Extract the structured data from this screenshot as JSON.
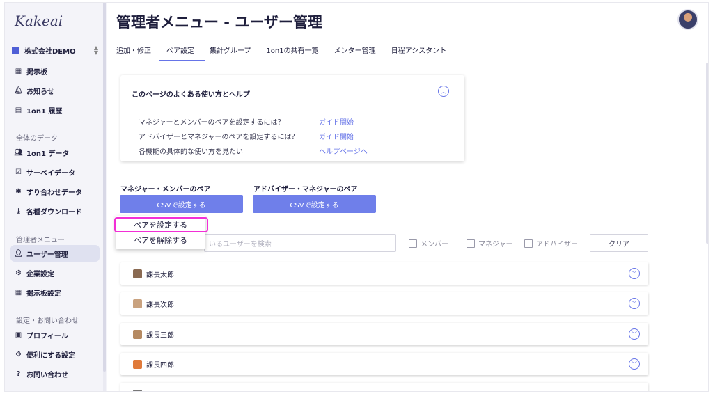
{
  "sidebar": {
    "logo": "Kakeai",
    "company": "株式会社DEMO",
    "top_items": [
      {
        "label": "掲示板",
        "icon": "board-icon"
      },
      {
        "label": "お知らせ",
        "icon": "bell-icon"
      },
      {
        "label": "1on1 履歴",
        "icon": "history-icon"
      }
    ],
    "section_data": "全体のデータ",
    "data_items": [
      {
        "label": "1on1 データ",
        "icon": "people-icon"
      },
      {
        "label": "サーベイデータ",
        "icon": "survey-icon"
      },
      {
        "label": "すり合わせデータ",
        "icon": "puzzle-icon"
      },
      {
        "label": "各種ダウンロード",
        "icon": "download-icon"
      }
    ],
    "section_admin": "管理者メニュー",
    "admin_items": [
      {
        "label": "ユーザー管理",
        "icon": "user-manage-icon",
        "active": true
      },
      {
        "label": "企業設定",
        "icon": "company-settings-icon"
      },
      {
        "label": "掲示板設定",
        "icon": "board-settings-icon"
      }
    ],
    "section_settings": "設定・お問い合わせ",
    "settings_items": [
      {
        "label": "プロフィール",
        "icon": "profile-icon"
      },
      {
        "label": "便利にする設定",
        "icon": "gear-icon"
      },
      {
        "label": "お問い合わせ",
        "icon": "help-icon"
      }
    ]
  },
  "header": {
    "title": "管理者メニュー - ユーザー管理"
  },
  "tabs": [
    {
      "label": "追加・修正"
    },
    {
      "label": "ペア設定",
      "active": true
    },
    {
      "label": "集計グループ"
    },
    {
      "label": "1on1の共有一覧"
    },
    {
      "label": "メンター管理"
    },
    {
      "label": "日程アシスタント"
    }
  ],
  "help": {
    "title": "このページのよくある使い方とヘルプ",
    "rows": [
      {
        "text": "マネジャーとメンバーのペアを設定するには？",
        "link": "ガイド開始"
      },
      {
        "text": "アドバイザーとマネジャーのペアを設定するには？",
        "link": "ガイド開始"
      },
      {
        "text": "各機能の具体的な使い方を見たい",
        "link": "ヘルプページへ"
      }
    ]
  },
  "pairs": {
    "manager_member_label": "マネジャー・メンバーのペア",
    "advisor_manager_label": "アドバイザー・マネジャーのペア",
    "csv_button": "CSVで設定する"
  },
  "dropdown": {
    "set_pair": "ペアを設定する",
    "remove_pair": "ペアを解除する"
  },
  "filters": {
    "search_placeholder": "いるユーザーを検索",
    "member": "メンバー",
    "manager": "マネジャー",
    "advisor": "アドバイザー",
    "clear": "クリア"
  },
  "users": [
    {
      "name": "課長太郎",
      "avatar_color": "#8a6a52"
    },
    {
      "name": "課長次郎",
      "avatar_color": "#c9a27f"
    },
    {
      "name": "課長三郎",
      "avatar_color": "#b58a62"
    },
    {
      "name": "課長四郎",
      "avatar_color": "#e07a3a"
    }
  ],
  "colors": {
    "accent": "#6674e8",
    "csv_button": "#6f7fea",
    "highlight_outline": "#f22fd6"
  }
}
